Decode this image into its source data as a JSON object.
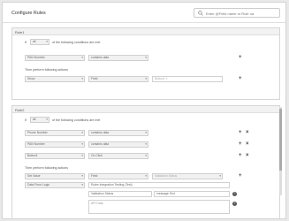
{
  "window": {
    "title": "Configure Rules"
  },
  "search": {
    "placeholder": "Enter @Field name or Rule na"
  },
  "rule1": {
    "header": "Rule1",
    "if_label": "If",
    "match": "all",
    "conditions_suffix": "of the following conditions are met",
    "conditions": [
      {
        "field": "PAN Number",
        "operator": "contains data"
      }
    ],
    "then_label": "Then perform following actions",
    "actions": [
      {
        "action": "Show",
        "target": "Field",
        "tags": [
          "Button1"
        ]
      }
    ]
  },
  "rule2": {
    "header": "Rule2",
    "if_label": "If",
    "match": "all",
    "conditions_suffix": "of the following conditions are met",
    "conditions": [
      {
        "field": "Phone Number",
        "operator": "contains data"
      },
      {
        "field": "PAN Number",
        "operator": "contains data"
      },
      {
        "field": "Button1",
        "operator": "On Click"
      }
    ],
    "then_label": "Then perform following actions",
    "actions": [
      {
        "action": "Set Value",
        "target": "Field",
        "value": "Validation Status",
        "source": "Data From Logic",
        "service": "Rules Integration Testing (Test)",
        "param_name": "Validation Status",
        "param_value": "message.Text",
        "textarea_placeholder": "API Data"
      }
    ]
  },
  "icons": {
    "plus": "+",
    "close": "×",
    "chevron": "▾",
    "help": "?"
  }
}
